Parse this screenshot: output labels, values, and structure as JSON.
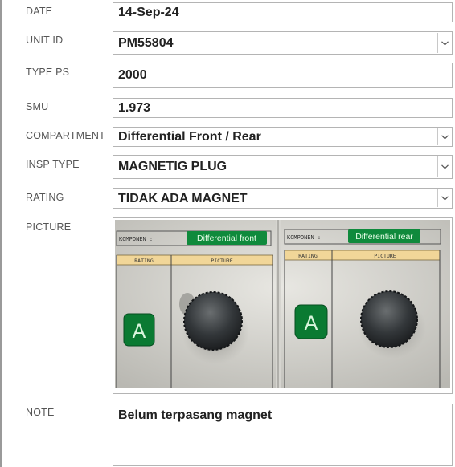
{
  "form": {
    "date": {
      "label": "DATE",
      "value": "14-Sep-24"
    },
    "unit_id": {
      "label": "UNIT ID",
      "value": "PM55804"
    },
    "type_ps": {
      "label": "TYPE PS",
      "value": "2000"
    },
    "smu": {
      "label": "SMU",
      "value": "1.973"
    },
    "compartment": {
      "label": "COMPARTMENT",
      "value": "Differential Front / Rear"
    },
    "insp_type": {
      "label": "INSP TYPE",
      "value": "MAGNETIG PLUG"
    },
    "rating": {
      "label": "RATING",
      "value": "TIDAK ADA MAGNET"
    },
    "picture": {
      "label": "PICTURE"
    },
    "note": {
      "label": "NOTE",
      "value": "Belum terpasang magnet"
    }
  },
  "photo": {
    "left_card": {
      "komponen": "KOMPONEN :",
      "tag": "Differential front",
      "col_rating": "RATING",
      "col_picture": "PICTURE",
      "grade": "A"
    },
    "right_card": {
      "komponen": "KOMPONEN :",
      "tag": "Differential rear",
      "col_rating": "RATING",
      "col_picture": "PICTURE",
      "grade": "A"
    }
  },
  "colors": {
    "label": "#555555",
    "value": "#222222",
    "border": "#b4b4b4",
    "tag_green": "#0f8a3c",
    "grade_green": "#0a7a32"
  },
  "icons": {
    "dropdown": "chevron-down-icon"
  }
}
